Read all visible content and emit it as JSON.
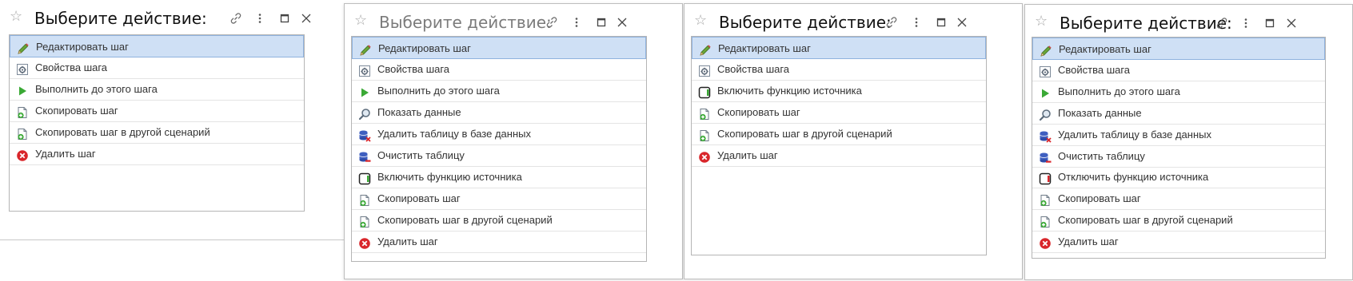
{
  "windows": [
    {
      "title": "Выберите действие:",
      "items": [
        {
          "label": "Редактировать шаг",
          "icon": "pencil-icon",
          "selected": true
        },
        {
          "label": "Свойства шага",
          "icon": "properties-icon"
        },
        {
          "label": "Выполнить до этого шага",
          "icon": "play-icon"
        },
        {
          "label": "Скопировать шаг",
          "icon": "copy-step-icon"
        },
        {
          "label": "Скопировать шаг в другой сценарий",
          "icon": "copy-step-icon"
        },
        {
          "label": "Удалить шаг",
          "icon": "delete-icon"
        }
      ]
    },
    {
      "title": "Выберите действие:",
      "items": [
        {
          "label": "Редактировать шаг",
          "icon": "pencil-icon",
          "selected": true
        },
        {
          "label": "Свойства шага",
          "icon": "properties-icon"
        },
        {
          "label": "Выполнить до этого шага",
          "icon": "play-icon"
        },
        {
          "label": "Показать данные",
          "icon": "magnifier-icon"
        },
        {
          "label": "Удалить таблицу в базе данных",
          "icon": "database-delete-icon"
        },
        {
          "label": "Очистить таблицу",
          "icon": "database-clear-icon"
        },
        {
          "label": "Включить функцию источника",
          "icon": "source-on-icon"
        },
        {
          "label": "Скопировать шаг",
          "icon": "copy-step-icon"
        },
        {
          "label": "Скопировать шаг в другой сценарий",
          "icon": "copy-step-icon"
        },
        {
          "label": "Удалить шаг",
          "icon": "delete-icon"
        }
      ]
    },
    {
      "title": "Выберите действие:",
      "items": [
        {
          "label": "Редактировать шаг",
          "icon": "pencil-icon",
          "selected": true
        },
        {
          "label": "Свойства шага",
          "icon": "properties-icon"
        },
        {
          "label": "Включить функцию источника",
          "icon": "source-on-icon"
        },
        {
          "label": "Скопировать шаг",
          "icon": "copy-step-icon"
        },
        {
          "label": "Скопировать шаг в другой сценарий",
          "icon": "copy-step-icon"
        },
        {
          "label": "Удалить шаг",
          "icon": "delete-icon"
        }
      ]
    },
    {
      "title": "Выберите действие:",
      "items": [
        {
          "label": "Редактировать шаг",
          "icon": "pencil-icon",
          "selected": true
        },
        {
          "label": "Свойства шага",
          "icon": "properties-icon"
        },
        {
          "label": "Выполнить до этого шага",
          "icon": "play-icon"
        },
        {
          "label": "Показать данные",
          "icon": "magnifier-icon"
        },
        {
          "label": "Удалить таблицу в базе данных",
          "icon": "database-delete-icon"
        },
        {
          "label": "Очистить таблицу",
          "icon": "database-clear-icon"
        },
        {
          "label": "Отключить функцию источника",
          "icon": "source-off-icon"
        },
        {
          "label": "Скопировать шаг",
          "icon": "copy-step-icon"
        },
        {
          "label": "Скопировать шаг в другой сценарий",
          "icon": "copy-step-icon"
        },
        {
          "label": "Удалить шаг",
          "icon": "delete-icon"
        }
      ]
    }
  ],
  "colors": {
    "selected_bg": "#cfe0f5",
    "selected_border": "#8fb2de",
    "list_border": "#b5b5b5",
    "delete_red": "#d9262b",
    "play_green": "#3aa935"
  }
}
